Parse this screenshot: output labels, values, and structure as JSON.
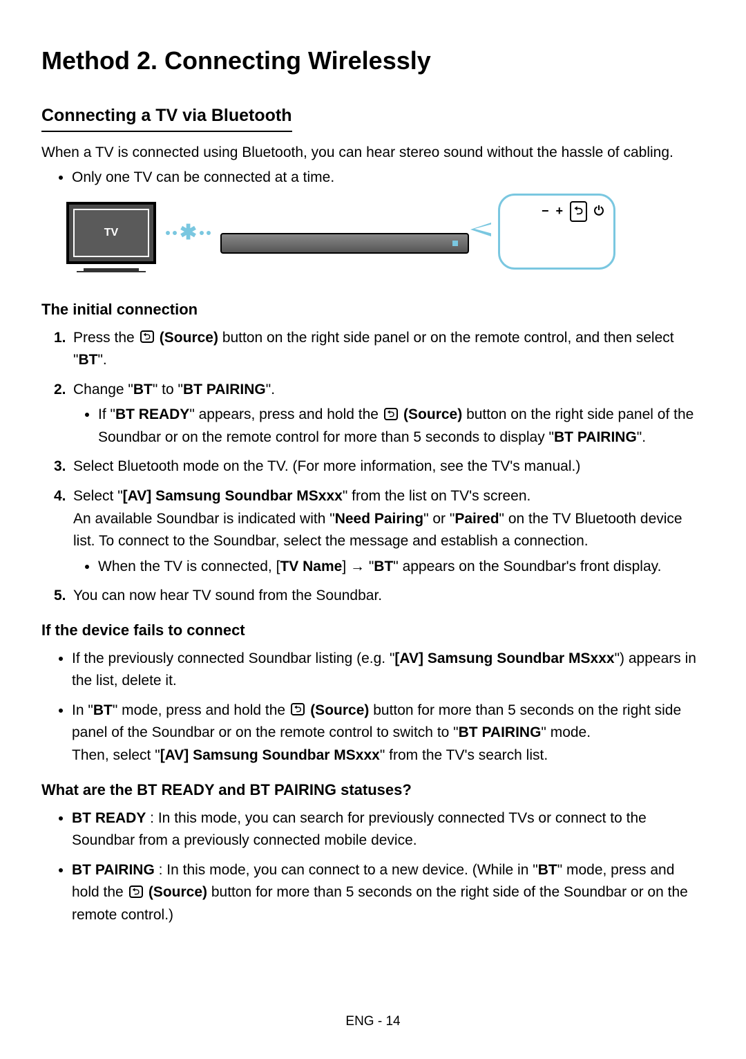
{
  "title": "Method 2. Connecting Wirelessly",
  "section1": {
    "heading": "Connecting a TV via Bluetooth",
    "intro": "When a TV is connected using Bluetooth, you can hear stereo sound without the hassle of cabling.",
    "bullet": "Only one TV can be connected at a time."
  },
  "diagram": {
    "tv_label": "TV",
    "panel_minus": "−",
    "panel_plus": "+",
    "panel_source": "⮌",
    "panel_power": "⏻"
  },
  "subheadings": {
    "initial": "The initial connection",
    "fails": "If the device fails to connect",
    "statuses": "What are the BT READY and BT PAIRING statuses?"
  },
  "steps": {
    "s1_a": "Press the ",
    "s1_b_bold": " (Source)",
    "s1_c": " button on the right side panel or on the remote control, and then select \"",
    "s1_d_bold": "BT",
    "s1_e": "\".",
    "s2_a": "Change \"",
    "s2_b_bold": "BT",
    "s2_c": "\" to \"",
    "s2_d_bold": "BT PAIRING",
    "s2_e": "\".",
    "s2_sub_a": "If \"",
    "s2_sub_b_bold": "BT READY",
    "s2_sub_c": "\" appears, press and hold the ",
    "s2_sub_d_bold": " (Source)",
    "s2_sub_e": " button on the right side panel of the Soundbar or on the remote control for more than 5 seconds to display \"",
    "s2_sub_f_bold": "BT PAIRING",
    "s2_sub_g": "\".",
    "s3": "Select Bluetooth mode on the TV. (For more information, see the TV's manual.)",
    "s4_a": "Select \"",
    "s4_b_bold": "[AV] Samsung Soundbar MSxxx",
    "s4_c": "\" from the list on TV's screen.",
    "s4_line2_a": "An available Soundbar is indicated with \"",
    "s4_line2_b_bold": "Need Pairing",
    "s4_line2_c": "\" or \"",
    "s4_line2_d_bold": "Paired",
    "s4_line2_e": "\" on the TV Bluetooth device list. To connect to the Soundbar, select the message and establish a connection.",
    "s4_sub_a": "When the TV is connected, [",
    "s4_sub_b_bold": "TV Name",
    "s4_sub_c": "] → \"",
    "s4_sub_d_bold": "BT",
    "s4_sub_e": "\" appears on the Soundbar's front display.",
    "s5": "You can now hear TV sound from the Soundbar."
  },
  "fails": {
    "b1_a": "If the previously connected Soundbar listing (e.g. \"",
    "b1_b_bold": "[AV] Samsung Soundbar MSxxx",
    "b1_c": "\") appears in the list, delete it.",
    "b2_a": "In \"",
    "b2_b_bold": "BT",
    "b2_c": "\" mode, press and hold the ",
    "b2_d_bold": " (Source)",
    "b2_e": " button for more than 5 seconds on the right side panel of the Soundbar or on the remote control to switch to \"",
    "b2_f_bold": "BT PAIRING",
    "b2_g": "\" mode.",
    "b2_line2_a": "Then, select \"",
    "b2_line2_b_bold": "[AV] Samsung Soundbar MSxxx",
    "b2_line2_c": "\" from the TV's search list."
  },
  "statuses": {
    "b1_bold": "BT READY",
    "b1_text": " : In this mode, you can search for previously connected TVs or connect to the Soundbar from a previously connected mobile device.",
    "b2_bold": "BT PAIRING",
    "b2_a": " : In this mode, you can connect to a new device. (While in \"",
    "b2_b_bold": "BT",
    "b2_c": "\" mode, press and hold the ",
    "b2_d_bold": " (Source)",
    "b2_e": " button for more than 5 seconds on the right side of the Soundbar or on the remote control.)"
  },
  "footer": "ENG - 14",
  "source_icon_text": "⮌"
}
